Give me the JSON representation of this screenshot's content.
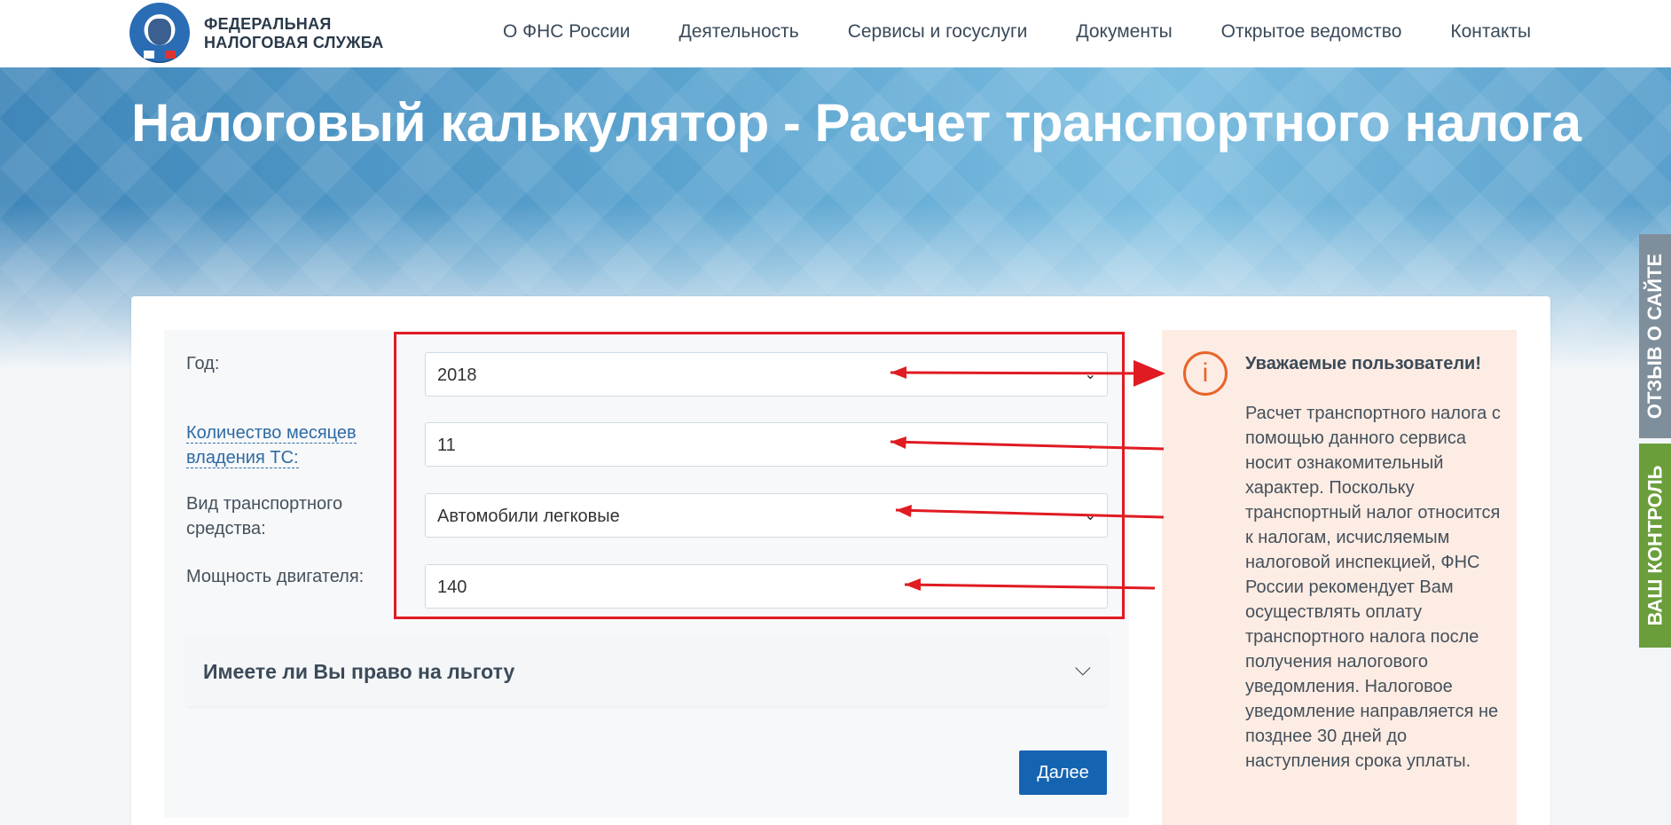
{
  "header": {
    "brand_line1": "ФЕДЕРАЛЬНАЯ",
    "brand_line2": "НАЛОГОВАЯ СЛУЖБА",
    "nav": [
      "О ФНС России",
      "Деятельность",
      "Сервисы и госуслуги",
      "Документы",
      "Открытое ведомство",
      "Контакты"
    ]
  },
  "hero": {
    "title": "Налоговый калькулятор - Расчет транспортного налога"
  },
  "side_tabs": {
    "feedback": "ОТЗЫВ О САЙТЕ",
    "control": "ВАШ КОНТРОЛЬ"
  },
  "form": {
    "year_label": "Год:",
    "year_value": "2018",
    "months_label": "Количество месяцев владения ТС:",
    "months_value": "11",
    "vehicle_label": "Вид транспортного средства:",
    "vehicle_value": "Автомобили легковые",
    "power_label": "Мощность двигателя:",
    "power_value": "140",
    "benefit_title": "Имеете ли Вы право на льготу",
    "next_label": "Далее"
  },
  "info": {
    "icon": "i",
    "heading": "Уважаемые пользователи!",
    "text": "Расчет транспортного налога с помощью данного сервиса носит ознакомительный характер. Поскольку транспортный налог относится к налогам, исчисляемым налоговой инспекцией, ФНС России рекомендует Вам осуществлять оплату транспортного налога после получения налогового уведомления. Налоговое уведомление направляется не позднее 30 дней до наступления срока уплаты."
  },
  "colors": {
    "accent": "#1564b2",
    "annotation": "#e01b22",
    "info_bg": "#fdece3",
    "info_icon": "#e8642a"
  }
}
